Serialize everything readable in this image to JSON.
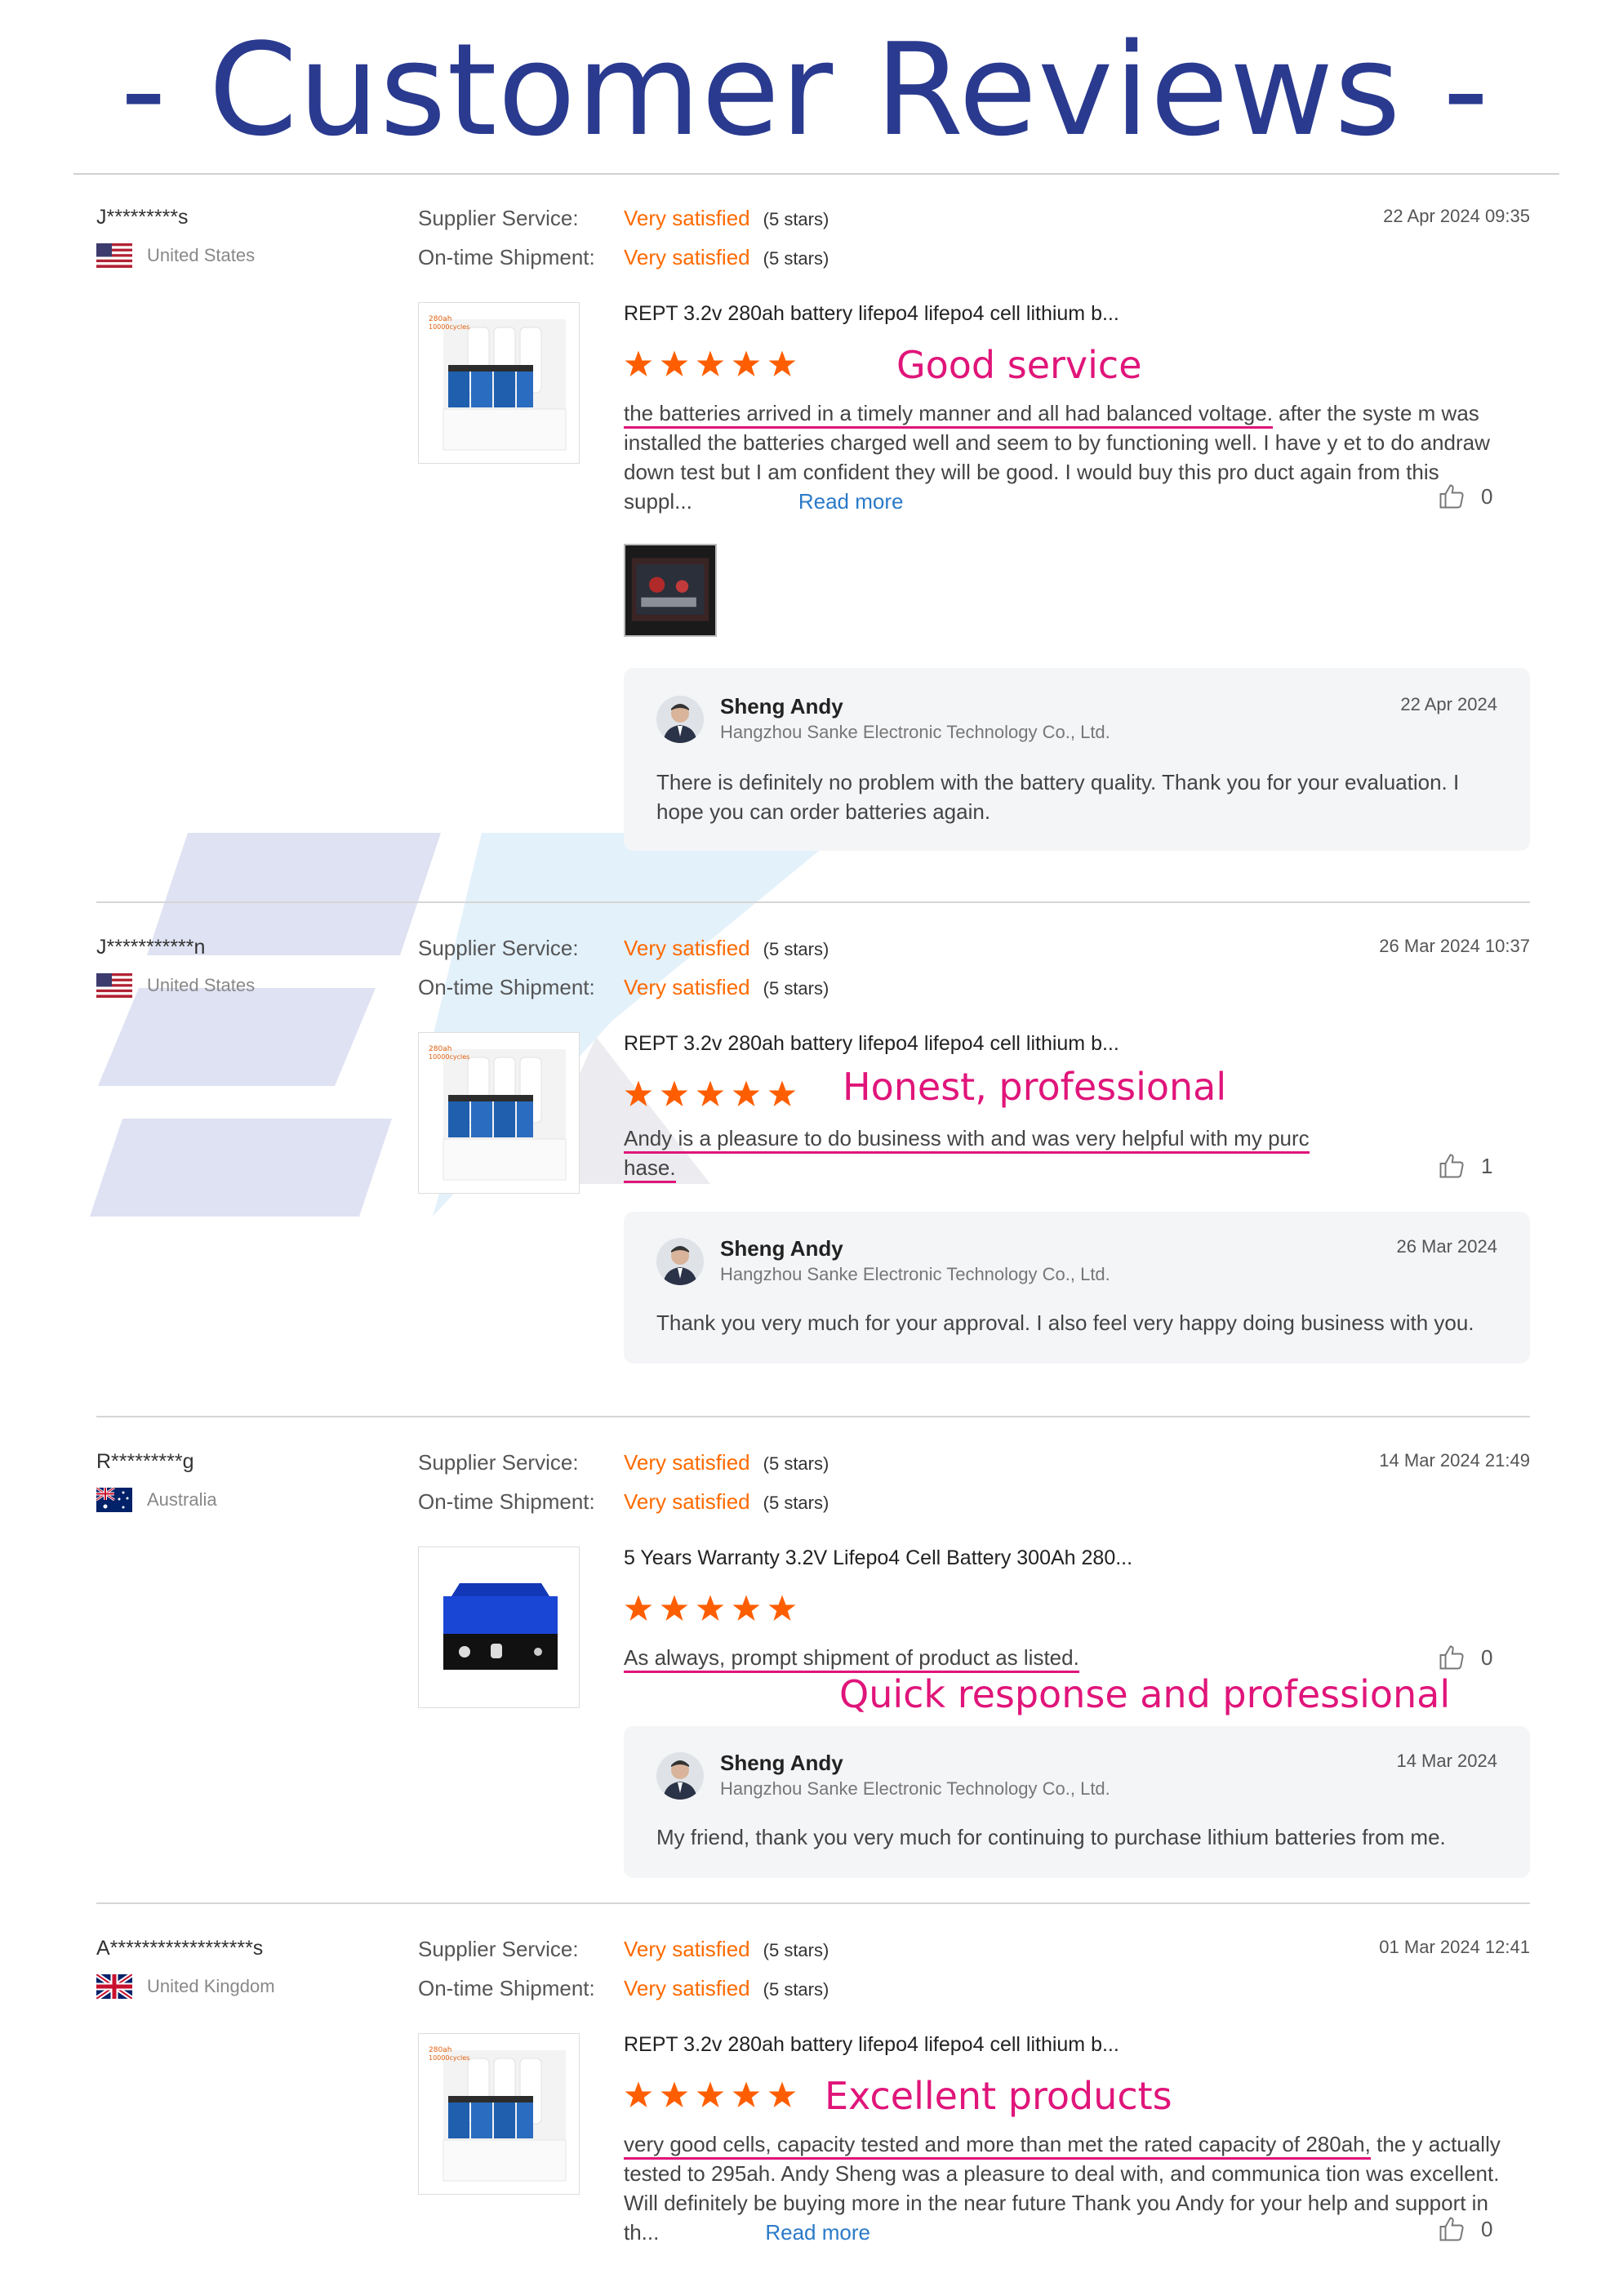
{
  "title": "- Customer Reviews -",
  "colors": {
    "title": "#2a3a8f",
    "accent_orange": "#ff6a00",
    "highlight_pink": "#e0157a",
    "link_blue": "#2a7ac8"
  },
  "labels": {
    "supplier_service": "Supplier Service:",
    "ontime_shipment": "On-time Shipment:",
    "read_more": "Read more"
  },
  "reviews": [
    {
      "reviewer": "J*********s",
      "country": "United States",
      "flag": "us-flag",
      "supplier_service": "Very satisfied",
      "supplier_stars": "(5 stars)",
      "shipment": "Very satisfied",
      "shipment_stars": "(5 stars)",
      "date": "22 Apr 2024 09:35",
      "product_title": "REPT 3.2v 280ah battery lifepo4 lifepo4 cell lithium b...",
      "rating": 5,
      "highlight": "Good service",
      "body_underlined": "the batteries arrived in a timely manner and all had balanced voltage.",
      "body_rest": " after the syste m was installed the batteries charged well and seem to by functioning well. I have y et to do andraw down test but I am confident they will be good. I would buy this pro duct again from this suppl...",
      "likes": "0",
      "reply": {
        "name": "Sheng Andy",
        "company": "Hangzhou Sanke Electronic Technology Co., Ltd.",
        "date": "22 Apr 2024",
        "text": "There is definitely no problem with the battery quality. Thank you for your evaluation. I hope you can order batteries again."
      }
    },
    {
      "reviewer": "J***********n",
      "country": "United States",
      "flag": "us-flag",
      "supplier_service": "Very satisfied",
      "supplier_stars": "(5 stars)",
      "shipment": "Very satisfied",
      "shipment_stars": "(5 stars)",
      "date": "26 Mar 2024 10:37",
      "product_title": "REPT 3.2v 280ah battery lifepo4 lifepo4 cell lithium b...",
      "rating": 5,
      "highlight": "Honest, professional",
      "body_line1": "Andy is a pleasure to do business with and was very helpful with my purc",
      "body_line2": "hase.",
      "likes": "1",
      "reply": {
        "name": "Sheng Andy",
        "company": "Hangzhou Sanke Electronic Technology Co., Ltd.",
        "date": "26 Mar 2024",
        "text": "Thank you very much for your approval. I also feel very happy doing business with you."
      }
    },
    {
      "reviewer": "R*********g",
      "country": "Australia",
      "flag": "au-flag",
      "supplier_service": "Very satisfied",
      "supplier_stars": "(5 stars)",
      "shipment": "Very satisfied",
      "shipment_stars": "(5 stars)",
      "date": "14 Mar 2024 21:49",
      "product_title": "5 Years Warranty 3.2V Lifepo4 Cell Battery 300Ah 280...",
      "rating": 5,
      "highlight": "Quick response and professional",
      "body_underlined": "As always, prompt shipment of product as listed.",
      "likes": "0",
      "reply": {
        "name": "Sheng Andy",
        "company": "Hangzhou Sanke Electronic Technology Co., Ltd.",
        "date": "14 Mar 2024",
        "text": "My friend, thank you very much for continuing to purchase lithium batteries from me."
      }
    },
    {
      "reviewer": "A******************s",
      "country": "United Kingdom",
      "flag": "uk-flag",
      "supplier_service": "Very satisfied",
      "supplier_stars": "(5 stars)",
      "shipment": "Very satisfied",
      "shipment_stars": "(5 stars)",
      "date": "01 Mar 2024 12:41",
      "product_title": "REPT 3.2v 280ah battery lifepo4 lifepo4 cell lithium b...",
      "rating": 5,
      "highlight": "Excellent products",
      "body_underlined": "very good cells, capacity tested and more than met the rated capacity of 280ah,",
      "body_rest": " the y actually tested to 295ah. Andy Sheng was a pleasure to deal with, and communica tion was excellent. Will definitely be buying more in the near future Thank you Andy for your help and support in th...",
      "likes": "0"
    }
  ]
}
